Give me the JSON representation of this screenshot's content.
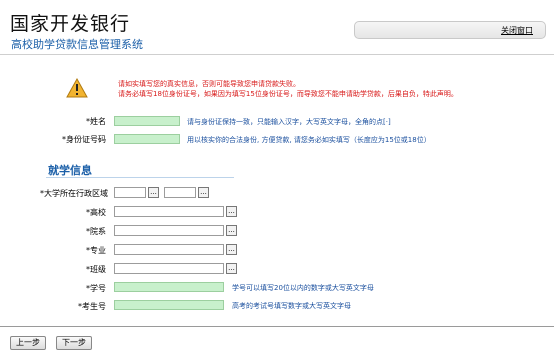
{
  "header": {
    "bank_name": "国家开发银行",
    "system_name": "高校助学贷款信息管理系统",
    "close_label": "关闭窗口"
  },
  "warning": {
    "line1": "请如实填写您的真实信息，否则可能导致您申请贷款失败。",
    "line2": "请务必填写18位身份证号，如果因为填写15位身份证号，而导致您不能申请助学贷款，后果自负，特此声明。"
  },
  "fields": {
    "name": {
      "label": "姓名",
      "required": "*",
      "value": "",
      "hint": "请与身份证保持一致，只能输入汉字，大写英文字母，全角的点[·]"
    },
    "id_number": {
      "label": "身份证号码",
      "required": "*",
      "value": "",
      "hint": "用以核实你的合法身份, 方便贷款, 请您务必如实填写（长度应为15位或18位）"
    }
  },
  "section": {
    "title": "就学信息"
  },
  "school_fields": {
    "region": {
      "label": "大学所在行政区域",
      "required": "*",
      "value1": "",
      "value2": ""
    },
    "school": {
      "label": "高校",
      "required": "*",
      "value": ""
    },
    "department": {
      "label": "院系",
      "required": "*",
      "value": ""
    },
    "major": {
      "label": "专业",
      "required": "*",
      "value": ""
    },
    "class": {
      "label": "班级",
      "required": "*",
      "value": ""
    },
    "student_no": {
      "label": "学号",
      "required": "*",
      "value": "",
      "hint": "学号可以填写20位以内的数字或大写英文字母"
    },
    "exam_no": {
      "label": "考生号",
      "required": "*",
      "value": "",
      "hint": "高考的考试号填写数字或大写英文字母"
    }
  },
  "picker_label": "...",
  "nav": {
    "prev_label": "上一步",
    "next_label": "下一步"
  },
  "colors": {
    "brand_blue": "#1b5fa8",
    "warning_red": "#d81818",
    "field_green": "#c8f0cc",
    "hint_blue": "#1a4f9e"
  }
}
